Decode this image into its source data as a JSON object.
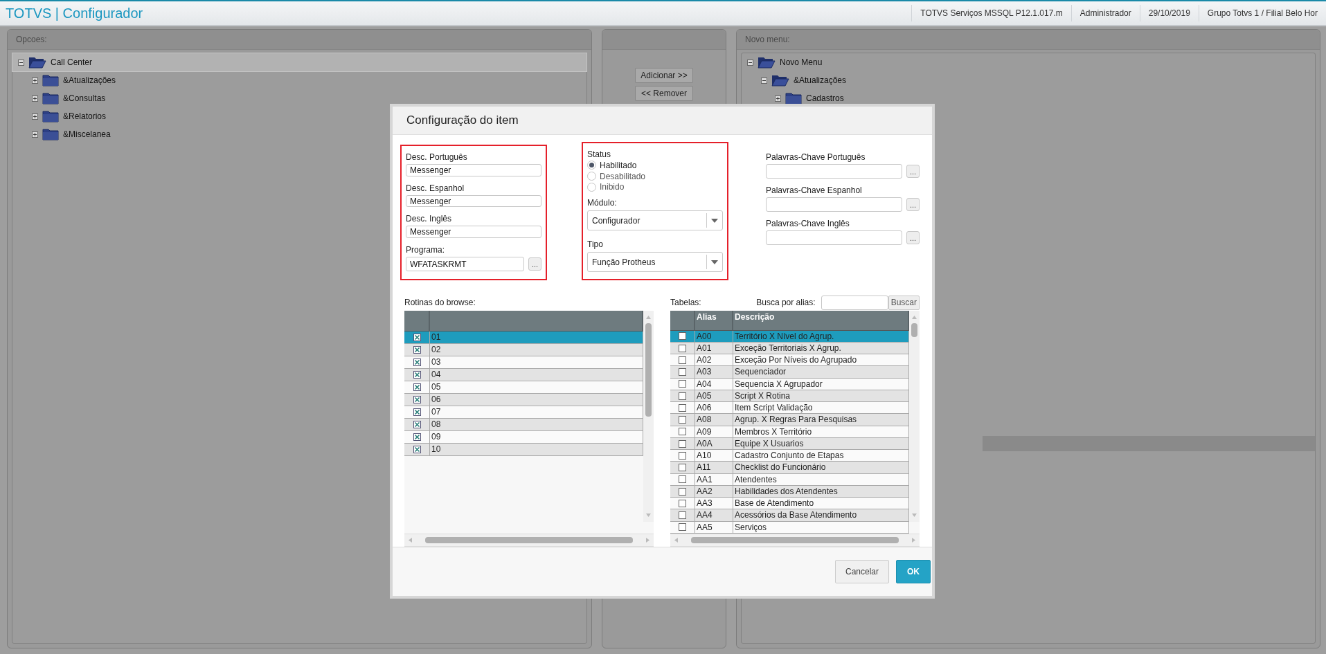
{
  "header": {
    "title": "TOTVS | Configurador",
    "info": [
      "TOTVS Serviços MSSQL P12.1.017.m",
      "Administrador",
      "29/10/2019",
      "Grupo Totvs 1 / Filial Belo Hor"
    ]
  },
  "options_panel": {
    "label": "Opcoes:",
    "tree": [
      {
        "label": "Call Center",
        "expanded": true,
        "selected": true,
        "children": [
          {
            "label": "&Atualizações",
            "expanded": false,
            "selected": false
          },
          {
            "label": "&Consultas",
            "expanded": false,
            "selected": false
          },
          {
            "label": "&Relatorios",
            "expanded": false,
            "selected": false
          },
          {
            "label": "&Miscelanea",
            "expanded": false,
            "selected": false
          }
        ]
      }
    ]
  },
  "middle_panel": {
    "buttons": [
      "Adicionar >>",
      "<< Remover"
    ]
  },
  "new_menu_panel": {
    "label": "Novo menu:",
    "tree": [
      {
        "label": "Novo Menu",
        "expanded": true,
        "selected": false,
        "children": [
          {
            "label": "&Atualizações",
            "expanded": true,
            "selected": false,
            "children": [
              {
                "label": "Cadastros",
                "expanded": false,
                "selected": false
              }
            ]
          }
        ]
      }
    ]
  },
  "dialog": {
    "title": "Configuração do item",
    "descriptions": [
      {
        "label": "Desc. Português",
        "value": "Messenger"
      },
      {
        "label": "Desc. Espanhol",
        "value": "Messenger"
      },
      {
        "label": "Desc. Inglês",
        "value": "Messenger"
      }
    ],
    "program": {
      "label": "Programa:",
      "value": "WFATASKRMT",
      "button": "..."
    },
    "status": {
      "label": "Status",
      "options": [
        {
          "label": "Habilitado",
          "selected": true
        },
        {
          "label": "Desabilitado",
          "selected": false
        },
        {
          "label": "Inibido",
          "selected": false
        }
      ]
    },
    "module": {
      "label": "Módulo:",
      "value": "Configurador"
    },
    "type": {
      "label": "Tipo",
      "value": "Função Protheus"
    },
    "keywords": [
      {
        "label": "Palavras-Chave Português",
        "button": "..."
      },
      {
        "label": "Palavras-Chave Espanhol",
        "button": "..."
      },
      {
        "label": "Palavras-Chave Inglês",
        "button": "..."
      }
    ],
    "routines": {
      "label": "Rotinas do browse:",
      "rows": [
        {
          "value": "01",
          "checked": true,
          "selected": true
        },
        {
          "value": "02",
          "checked": true,
          "selected": false
        },
        {
          "value": "03",
          "checked": true,
          "selected": false
        },
        {
          "value": "04",
          "checked": true,
          "selected": false
        },
        {
          "value": "05",
          "checked": true,
          "selected": false
        },
        {
          "value": "06",
          "checked": true,
          "selected": false
        },
        {
          "value": "07",
          "checked": true,
          "selected": false
        },
        {
          "value": "08",
          "checked": true,
          "selected": false
        },
        {
          "value": "09",
          "checked": true,
          "selected": false
        },
        {
          "value": "10",
          "checked": true,
          "selected": false
        }
      ]
    },
    "tables": {
      "label": "Tabelas:",
      "search_label": "Busca por alias:",
      "search_button": "Buscar",
      "columns": [
        "Alias",
        "Descrição"
      ],
      "rows": [
        {
          "alias": "A00",
          "description": "Território X Nível do Agrup.",
          "checked": false,
          "selected": true
        },
        {
          "alias": "A01",
          "description": "Exceção Territoriais X Agrup.",
          "checked": false,
          "selected": false
        },
        {
          "alias": "A02",
          "description": "Exceção Por Níveis do Agrupado",
          "checked": false,
          "selected": false
        },
        {
          "alias": "A03",
          "description": "Sequenciador",
          "checked": false,
          "selected": false
        },
        {
          "alias": "A04",
          "description": "Sequencia X Agrupador",
          "checked": false,
          "selected": false
        },
        {
          "alias": "A05",
          "description": "Script X Rotina",
          "checked": false,
          "selected": false
        },
        {
          "alias": "A06",
          "description": "Item Script Validação",
          "checked": false,
          "selected": false
        },
        {
          "alias": "A08",
          "description": "Agrup. X Regras Para Pesquisas",
          "checked": false,
          "selected": false
        },
        {
          "alias": "A09",
          "description": "Membros X Território",
          "checked": false,
          "selected": false
        },
        {
          "alias": "A0A",
          "description": "Equipe X Usuarios",
          "checked": false,
          "selected": false
        },
        {
          "alias": "A10",
          "description": "Cadastro Conjunto de Etapas",
          "checked": false,
          "selected": false
        },
        {
          "alias": "A11",
          "description": "Checklist do Funcionário",
          "checked": false,
          "selected": false
        },
        {
          "alias": "AA1",
          "description": "Atendentes",
          "checked": false,
          "selected": false
        },
        {
          "alias": "AA2",
          "description": "Habilidades dos Atendentes",
          "checked": false,
          "selected": false
        },
        {
          "alias": "AA3",
          "description": "Base de Atendimento",
          "checked": false,
          "selected": false
        },
        {
          "alias": "AA4",
          "description": "Acessórios da Base Atendimento",
          "checked": false,
          "selected": false
        },
        {
          "alias": "AA5",
          "description": "Serviços",
          "checked": false,
          "selected": false
        }
      ]
    },
    "buttons": [
      {
        "label": "Cancelar",
        "kind": "secondary"
      },
      {
        "label": "OK",
        "kind": "primary"
      }
    ]
  }
}
